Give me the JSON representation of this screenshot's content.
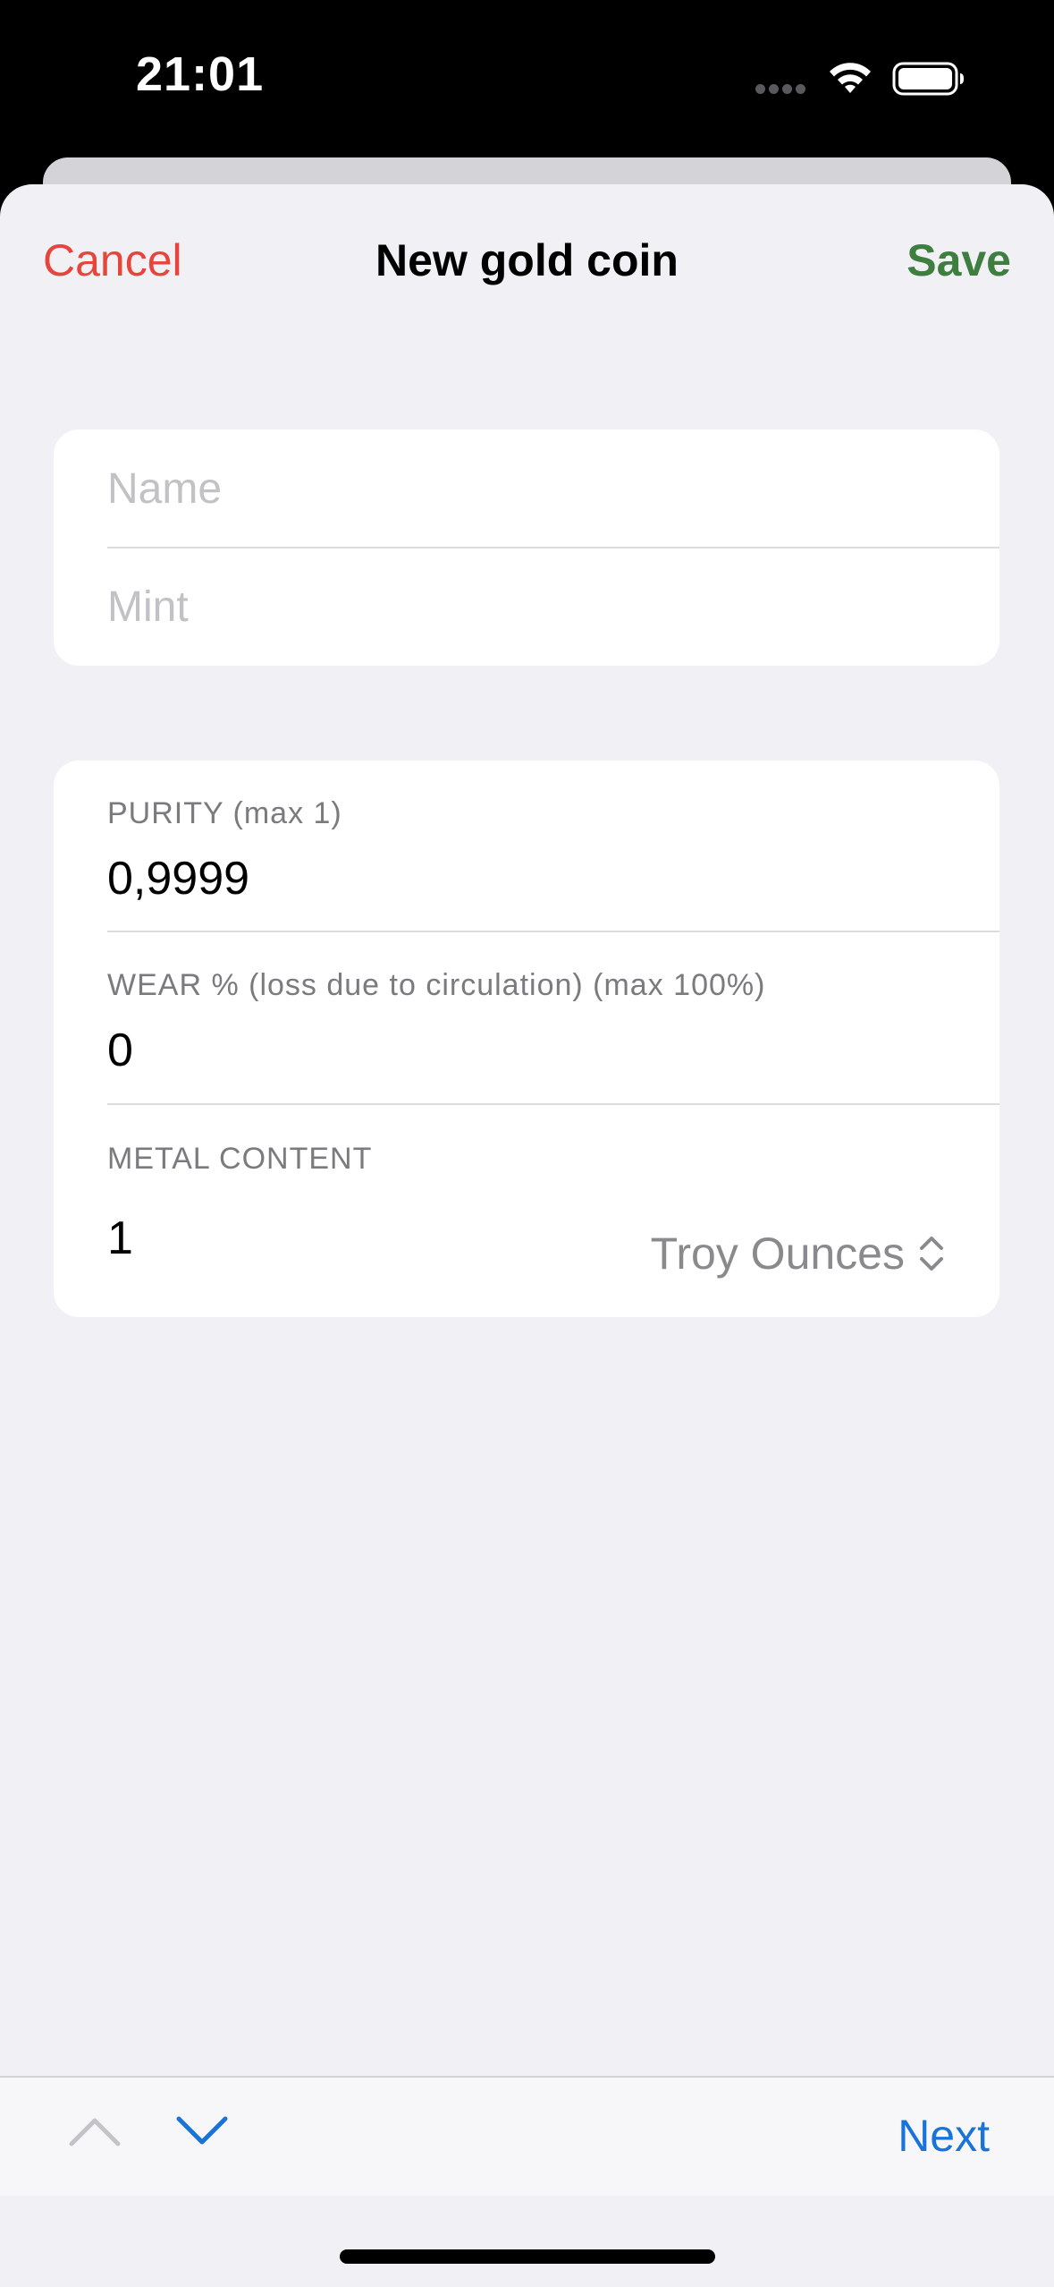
{
  "status_bar": {
    "time": "21:01"
  },
  "nav": {
    "cancel_label": "Cancel",
    "title": "New gold coin",
    "save_label": "Save"
  },
  "identity_group": {
    "name_placeholder": "Name",
    "name_value": "",
    "mint_placeholder": "Mint",
    "mint_value": ""
  },
  "details_group": {
    "purity_label": "PURITY (max 1)",
    "purity_value": "0,9999",
    "wear_label": "WEAR % (loss due to circulation) (max 100%)",
    "wear_value": "0",
    "metal_content_label": "METAL CONTENT",
    "metal_content_value": "1",
    "unit_label": "Troy Ounces"
  },
  "accessory": {
    "next_label": "Next"
  },
  "colors": {
    "cancel": "#e5453b",
    "save": "#3e7e3f",
    "accent": "#1a73d9",
    "sheet_bg": "#f0f0f5"
  },
  "icons": [
    "wifi-icon",
    "battery-icon",
    "updown-chevron-icon",
    "chevron-up-icon",
    "chevron-down-icon"
  ]
}
